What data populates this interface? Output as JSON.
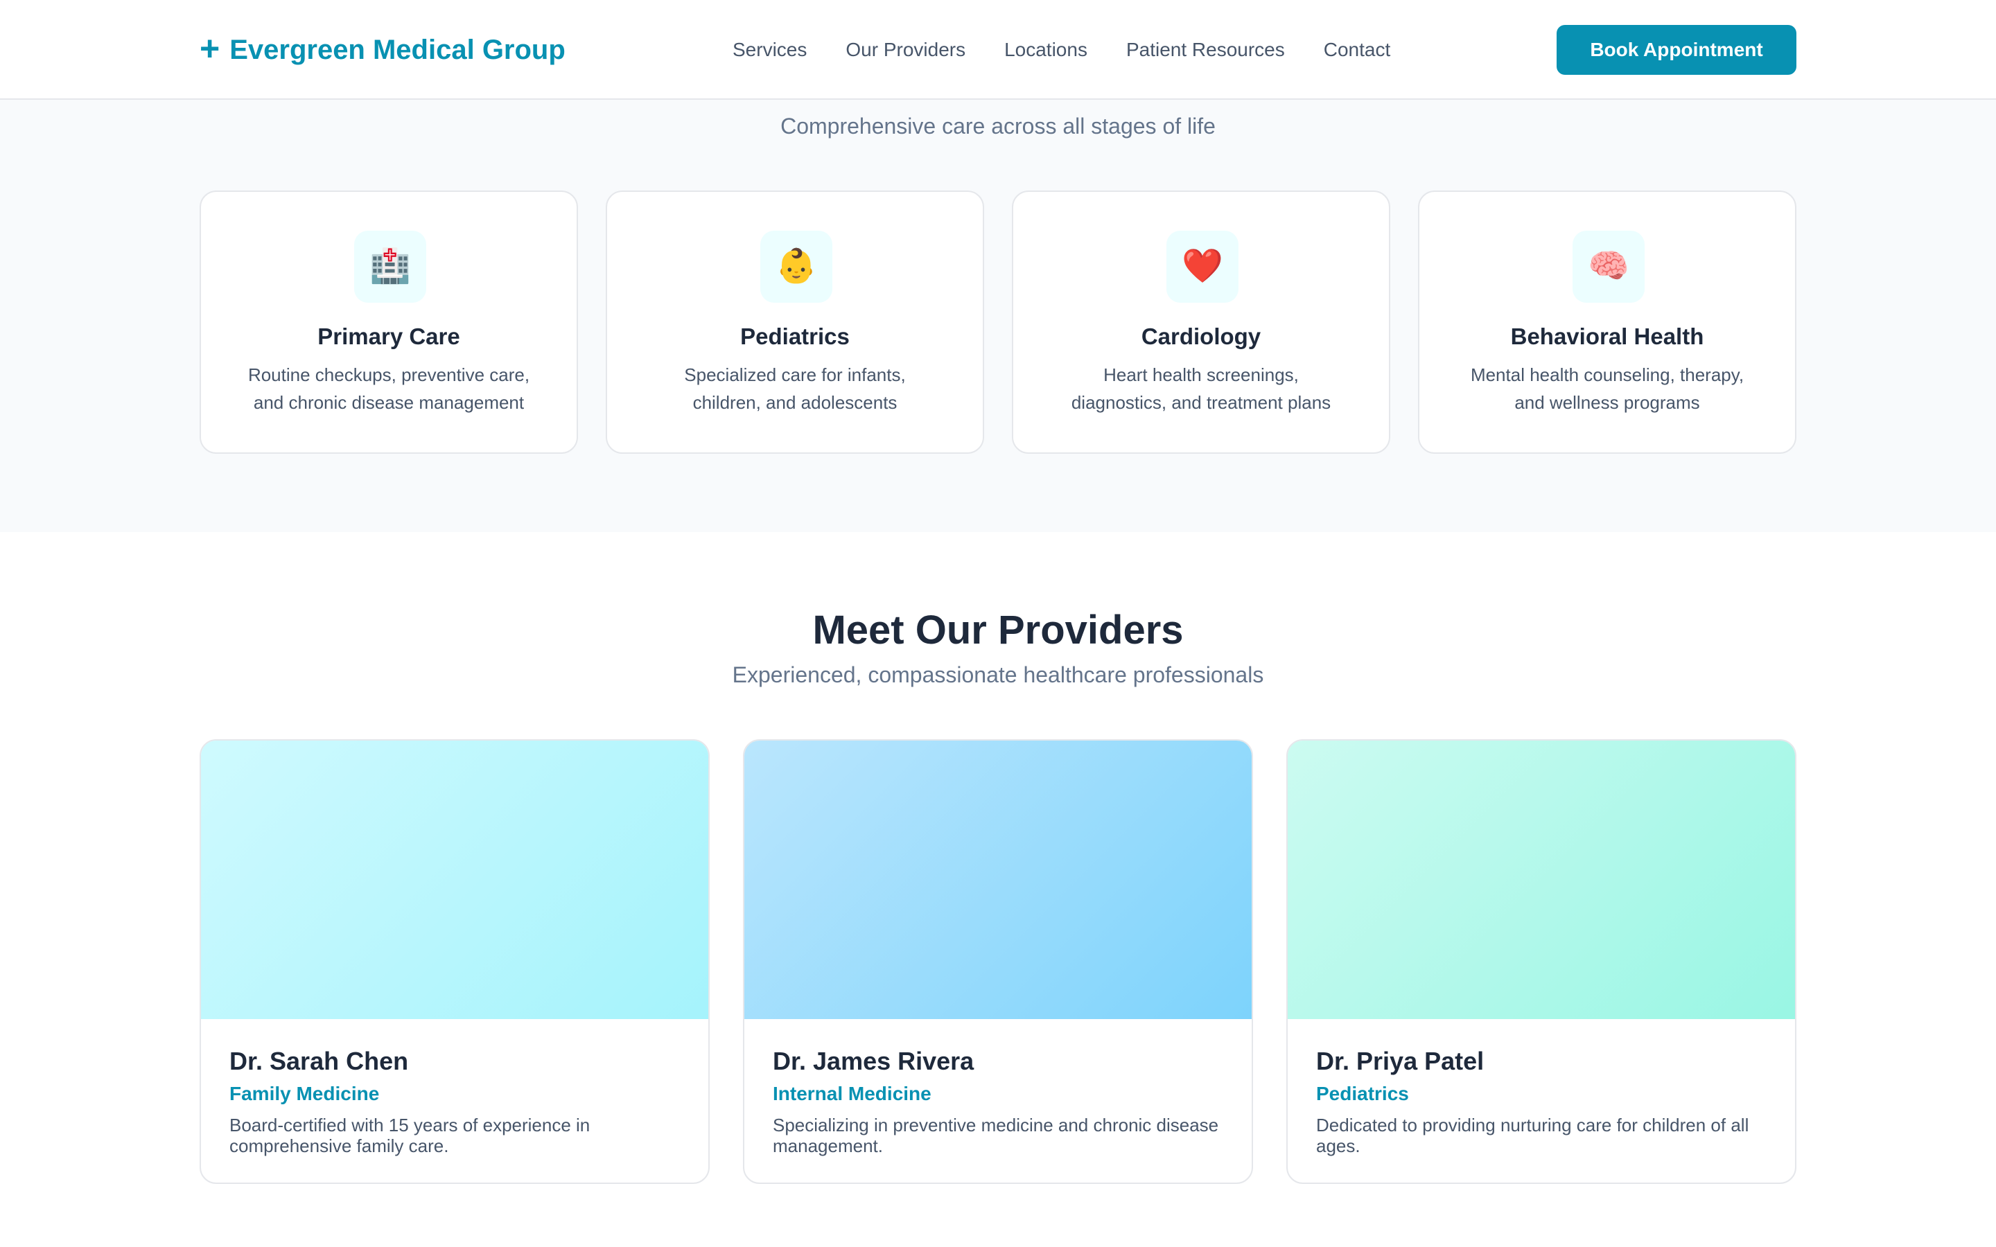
{
  "header": {
    "logo_icon": "+",
    "logo_text": "Evergreen Medical Group",
    "nav": [
      "Services",
      "Our Providers",
      "Locations",
      "Patient Resources",
      "Contact"
    ],
    "cta_label": "Book Appointment"
  },
  "services": {
    "subtitle": "Comprehensive care across all stages of life",
    "cards": [
      {
        "icon": "🏥",
        "icon_name": "hospital-icon",
        "title": "Primary Care",
        "desc": "Routine checkups, preventive care, and chronic disease management"
      },
      {
        "icon": "👶",
        "icon_name": "baby-icon",
        "title": "Pediatrics",
        "desc": "Specialized care for infants, children, and adolescents"
      },
      {
        "icon": "❤️",
        "icon_name": "heart-icon",
        "title": "Cardiology",
        "desc": "Heart health screenings, diagnostics, and treatment plans"
      },
      {
        "icon": "🧠",
        "icon_name": "brain-icon",
        "title": "Behavioral Health",
        "desc": "Mental health counseling, therapy, and wellness programs"
      }
    ]
  },
  "providers": {
    "title": "Meet Our Providers",
    "subtitle": "Experienced, compassionate healthcare professionals",
    "cards": [
      {
        "name": "Dr. Sarah Chen",
        "specialty": "Family Medicine",
        "bio": "Board-certified with 15 years of experience in comprehensive family care.",
        "gradient": [
          "#cffafe",
          "#a5f3fc"
        ]
      },
      {
        "name": "Dr. James Rivera",
        "specialty": "Internal Medicine",
        "bio": "Specializing in preventive medicine and chronic disease management.",
        "gradient": [
          "#bae6fd",
          "#7dd3fc"
        ]
      },
      {
        "name": "Dr. Priya Patel",
        "specialty": "Pediatrics",
        "bio": "Dedicated to providing nurturing care for children of all ages.",
        "gradient": [
          "#ccfbf1",
          "#99f6e4"
        ]
      }
    ]
  },
  "colors": {
    "accent": "#0891b2",
    "text": "#1e293b",
    "muted": "#475569",
    "section_bg": "#f8fafc"
  }
}
